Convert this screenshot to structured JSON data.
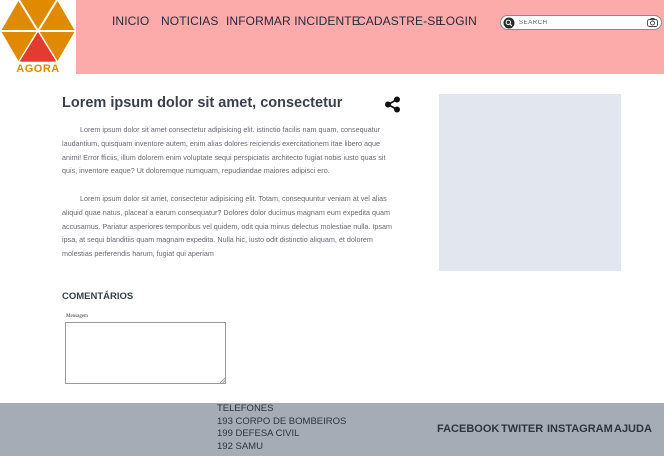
{
  "brand": {
    "name": "AGORA",
    "logo_colors": [
      "#e08a00",
      "#e33b2e"
    ]
  },
  "nav": {
    "items": [
      {
        "label": "INICIO"
      },
      {
        "label": "NOTICIAS"
      },
      {
        "label": "INFORMAR INCIDENTE"
      },
      {
        "label": "CADASTRE-SE"
      },
      {
        "label": "LOGIN"
      }
    ]
  },
  "search": {
    "placeholder": "SEARCH",
    "icon": "search-icon",
    "camera_icon": "camera-icon"
  },
  "article": {
    "title": "Lorem ipsum dolor sit amet, consectetur",
    "share_icon": "share-icon",
    "paragraphs": [
      "Lorem ipsum dolor sit amet consectetur adipisicing elit. istinctio facilis nam quam, consequatur laudantium, quisquam  inventore autem, enim alias dolores reiciendis exercitationem itae libero aque animi! Error fficiis, illum dolorem enim  voluptate sequi perspiciatis architecto fugiat nobis iusto quas   sit quis, inventore eaque? Ut doloremque numquam, repudiandae  maiores adipisci ero.",
      "Lorem ipsum dolor sit amet, consectetur adipisicing elit. Totam, consequuntur veniam at vel alias aliquid quae natus, placeat a earum consequatur? Dolores dolor ducimus magnam eum expedita quam accusamus. Pariatur asperiores temporibus vel quidem, odit quia minus delectus molestiae nulla. Ipsam ipsa, at sequi blanditiis quam magnam expedita. Nulla hic, iusto odit distinctio aliquam, et dolorem molestias perferendis harum, fugiat qui aperiam"
    ]
  },
  "comments": {
    "title": "COMENTÁRIOS",
    "message_label": "Mensagem",
    "message_value": ""
  },
  "footer": {
    "phones": [
      "TELEFONES",
      "193 CORPO DE BOMBEIROS",
      "199 DEFESA CIVIL",
      "192 SAMU"
    ],
    "social": [
      {
        "label": "FACEBOOK"
      },
      {
        "label": "TWITER"
      },
      {
        "label": "INSTAGRAM"
      },
      {
        "label": "AJUDA"
      }
    ]
  },
  "colors": {
    "header_bg": "#fcaaaa",
    "footer_bg": "#a5acb6",
    "sidebar_placeholder": "#e1e6ef"
  }
}
